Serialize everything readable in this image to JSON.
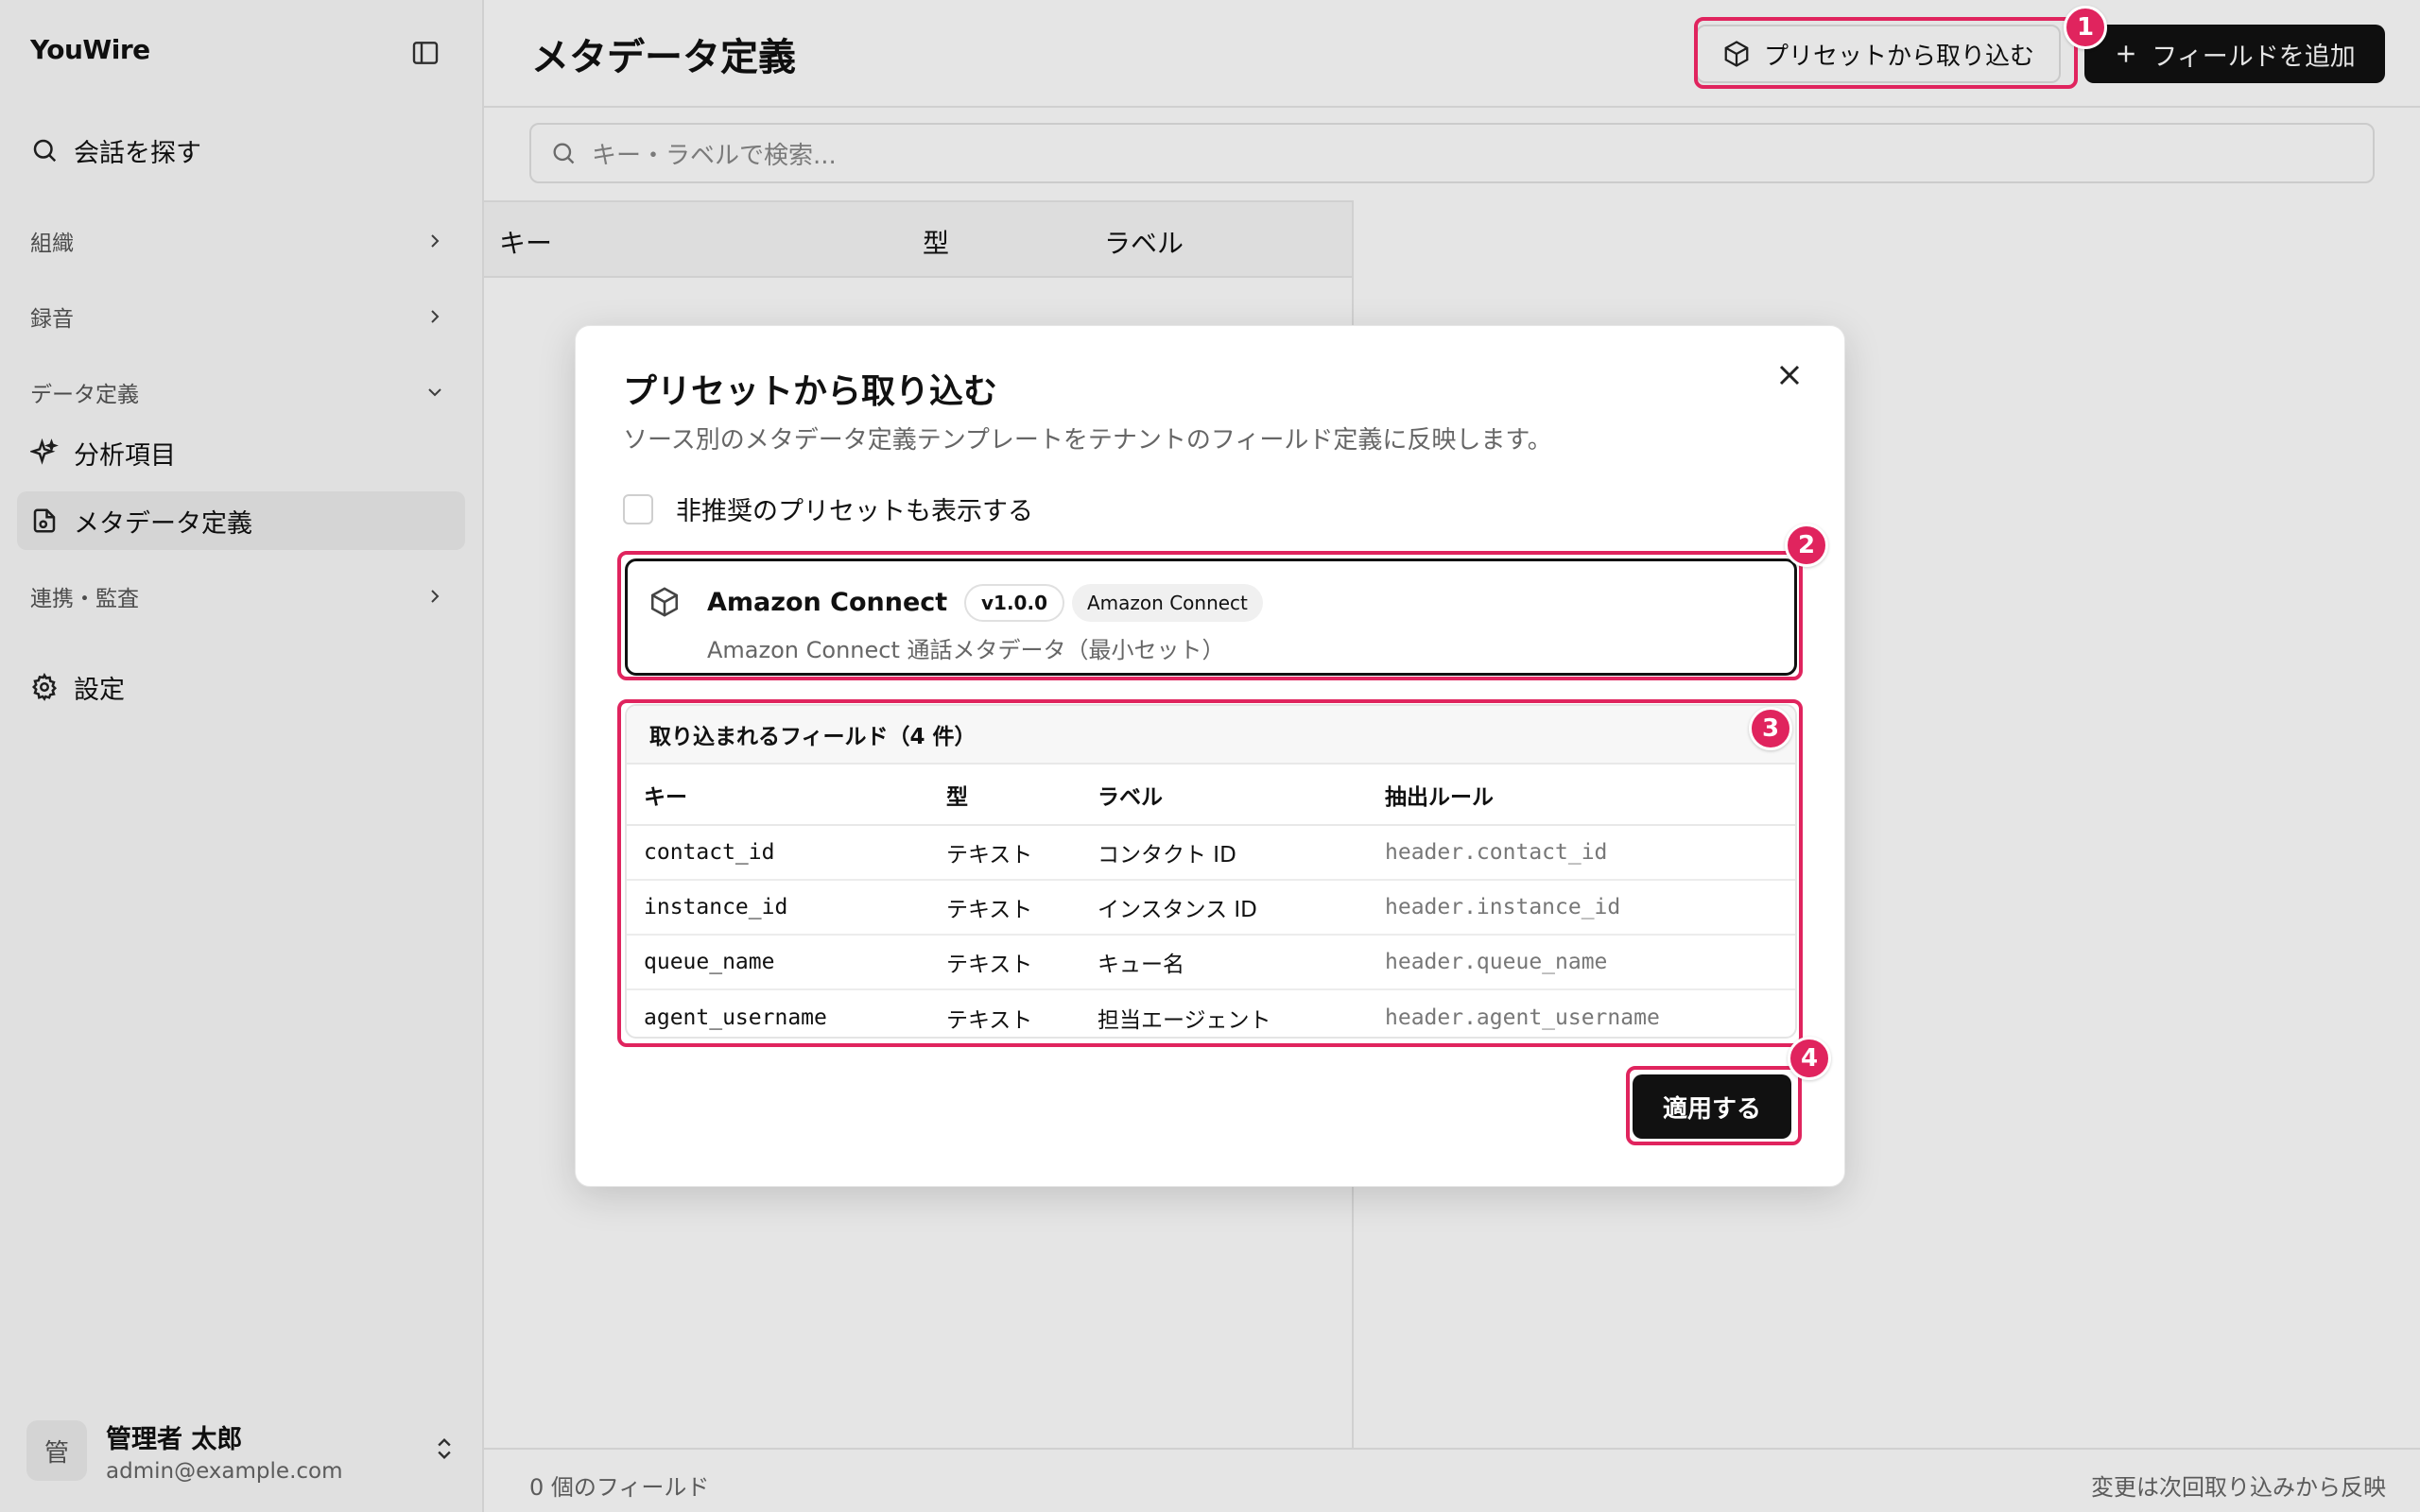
{
  "sidebar": {
    "brand": "YouWire",
    "search_label": "会話を探す",
    "group_org": "組織",
    "group_recording": "録音",
    "group_data": "データ定義",
    "item_analysis": "分析項目",
    "item_metadata": "メタデータ定義",
    "group_integration": "連携・監査",
    "item_settings": "設定",
    "user": {
      "initial": "管",
      "name": "管理者 太郎",
      "email": "admin@example.com"
    }
  },
  "header": {
    "title": "メタデータ定義",
    "import_label": "プリセットから取り込む",
    "add_label": "フィールドを追加"
  },
  "search": {
    "placeholder": "キー・ラベルで検索..."
  },
  "list": {
    "col_key": "キー",
    "col_type": "型",
    "col_label": "ラベル"
  },
  "footer": {
    "count": "0 個のフィールド",
    "note": "変更は次回取り込みから反映"
  },
  "modal": {
    "title": "プリセットから取り込む",
    "description": "ソース別のメタデータ定義テンプレートをテナントのフィールド定義に反映します。",
    "show_deprecated": "非推奨のプリセットも表示する",
    "preset": {
      "name": "Amazon Connect",
      "version": "v1.0.0",
      "source": "Amazon Connect",
      "description": "Amazon Connect 通話メタデータ（最小セット）"
    },
    "fields_title": "取り込まれるフィールド（4 件）",
    "columns": {
      "key": "キー",
      "type": "型",
      "label": "ラベル",
      "rule": "抽出ルール"
    },
    "rows": [
      {
        "key": "contact_id",
        "type": "テキスト",
        "label": "コンタクト ID",
        "rule": "header.contact_id"
      },
      {
        "key": "instance_id",
        "type": "テキスト",
        "label": "インスタンス ID",
        "rule": "header.instance_id"
      },
      {
        "key": "queue_name",
        "type": "テキスト",
        "label": "キュー名",
        "rule": "header.queue_name"
      },
      {
        "key": "agent_username",
        "type": "テキスト",
        "label": "担当エージェント",
        "rule": "header.agent_username"
      }
    ],
    "apply_label": "適用する"
  },
  "annotations": [
    "1",
    "2",
    "3",
    "4"
  ],
  "colors": {
    "highlight": "#e0245e",
    "primary": "#111111"
  }
}
